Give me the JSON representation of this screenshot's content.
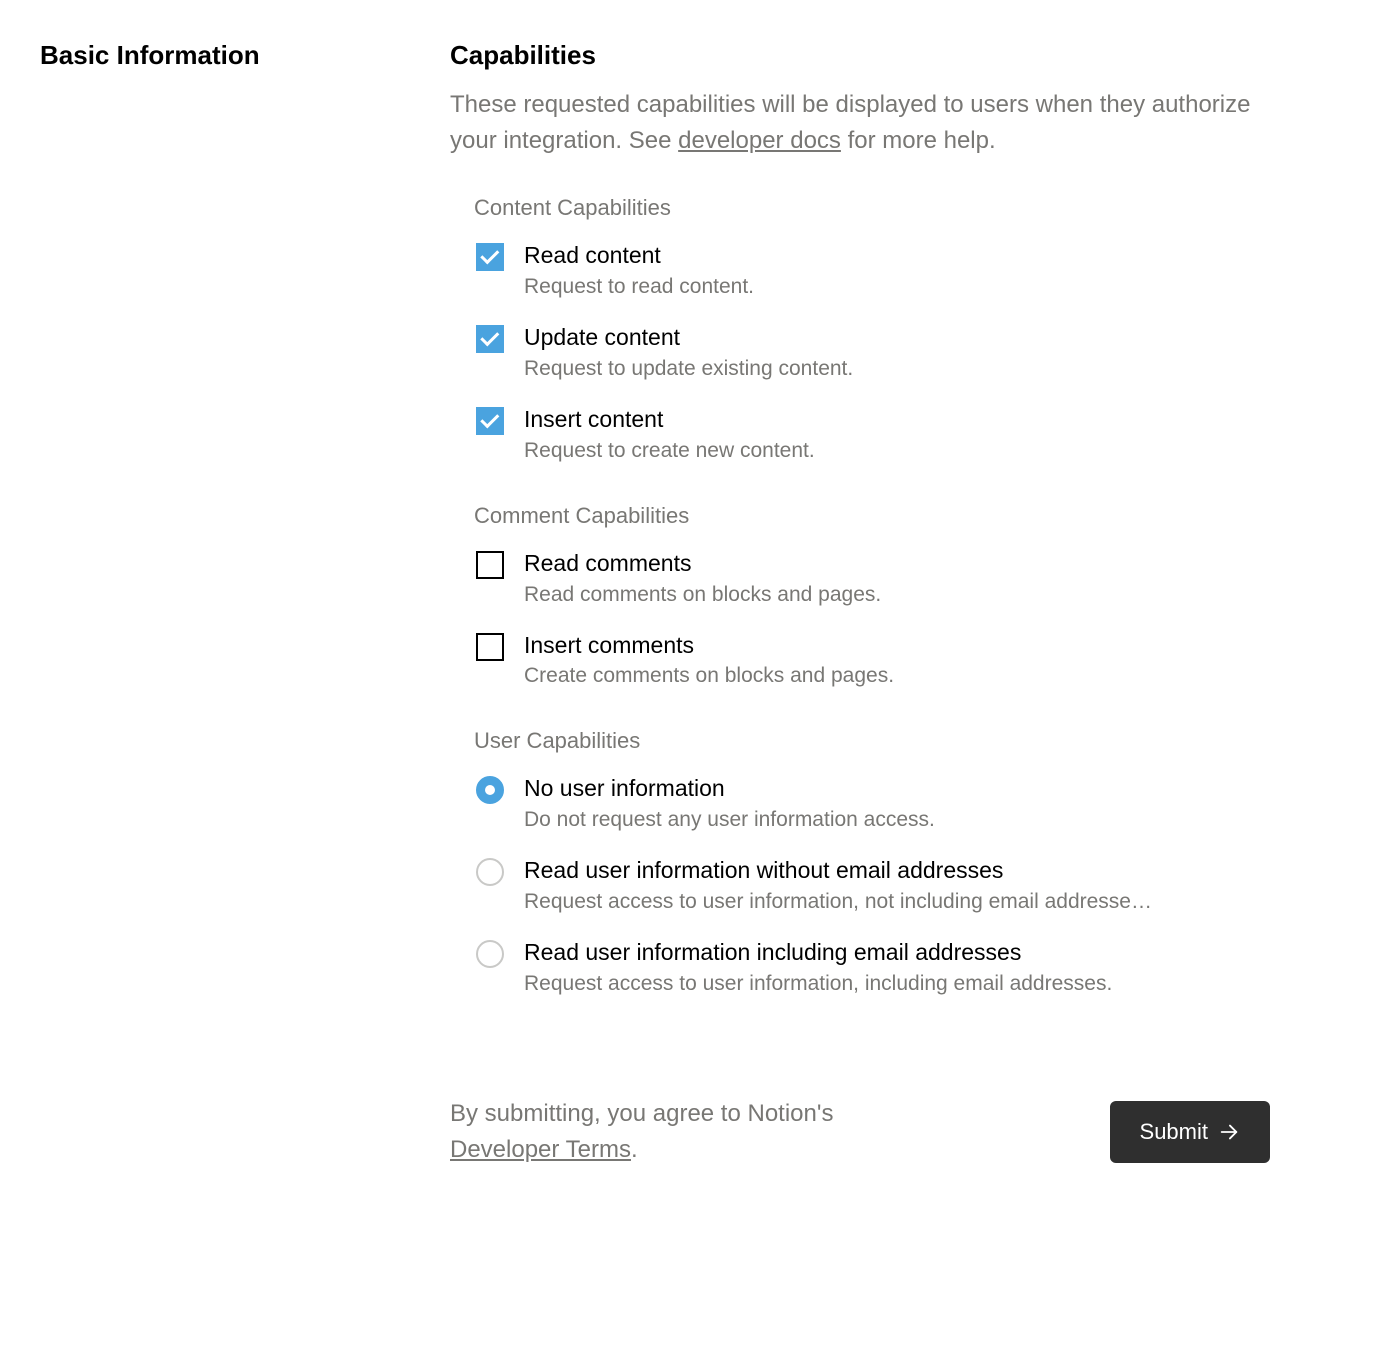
{
  "sidebar": {
    "title": "Basic Information"
  },
  "capabilities": {
    "title": "Capabilities",
    "desc_before": "These requested capabilities will be displayed to users when they authorize your integration. See ",
    "desc_link": "developer docs",
    "desc_after": " for more help.",
    "content": {
      "heading": "Content Capabilities",
      "items": [
        {
          "label": "Read content",
          "desc": "Request to read content.",
          "checked": true
        },
        {
          "label": "Update content",
          "desc": "Request to update existing content.",
          "checked": true
        },
        {
          "label": "Insert content",
          "desc": "Request to create new content.",
          "checked": true
        }
      ]
    },
    "comment": {
      "heading": "Comment Capabilities",
      "items": [
        {
          "label": "Read comments",
          "desc": "Read comments on blocks and pages.",
          "checked": false
        },
        {
          "label": "Insert comments",
          "desc": "Create comments on blocks and pages.",
          "checked": false
        }
      ]
    },
    "user": {
      "heading": "User Capabilities",
      "items": [
        {
          "label": "No user information",
          "desc": "Do not request any user information access.",
          "selected": true
        },
        {
          "label": "Read user information without email addresses",
          "desc": "Request access to user information, not including email addresse…",
          "selected": false
        },
        {
          "label": "Read user information including email addresses",
          "desc": "Request access to user information, including email addresses.",
          "selected": false
        }
      ]
    }
  },
  "footer": {
    "text_before": "By submitting, you agree to Notion's ",
    "link": "Developer Terms",
    "text_after": ".",
    "submit_label": "Submit"
  }
}
